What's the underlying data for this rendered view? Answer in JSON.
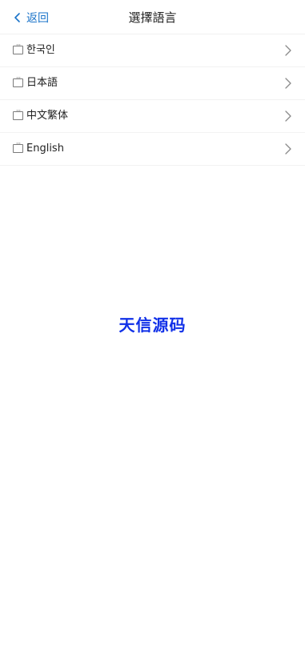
{
  "nav": {
    "back_label": "返回",
    "title": "選擇語言"
  },
  "languages": [
    {
      "label": "한국인"
    },
    {
      "label": "日本語"
    },
    {
      "label": "中文繁体"
    },
    {
      "label": "English"
    }
  ],
  "watermark": "天信源码",
  "colors": {
    "accent": "#1a73c9",
    "watermark": "#1030e8",
    "text": "#222222",
    "divider": "#f2f2f2"
  }
}
